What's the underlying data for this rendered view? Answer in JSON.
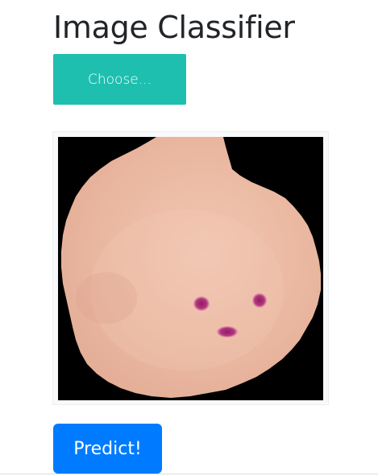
{
  "header": {
    "title": "Image Classifier"
  },
  "upload": {
    "choose_label": "Choose..."
  },
  "preview": {
    "subject": "blood-cell-image",
    "colors": {
      "background": "#000000",
      "cell": "#e8b39c",
      "cell_highlight": "#f0c6b0",
      "stain": "#b0307a"
    }
  },
  "actions": {
    "predict_label": "Predict!"
  },
  "theme": {
    "choose_color": "#1fbfb0",
    "predict_color": "#007bff",
    "title_color": "#212529"
  }
}
